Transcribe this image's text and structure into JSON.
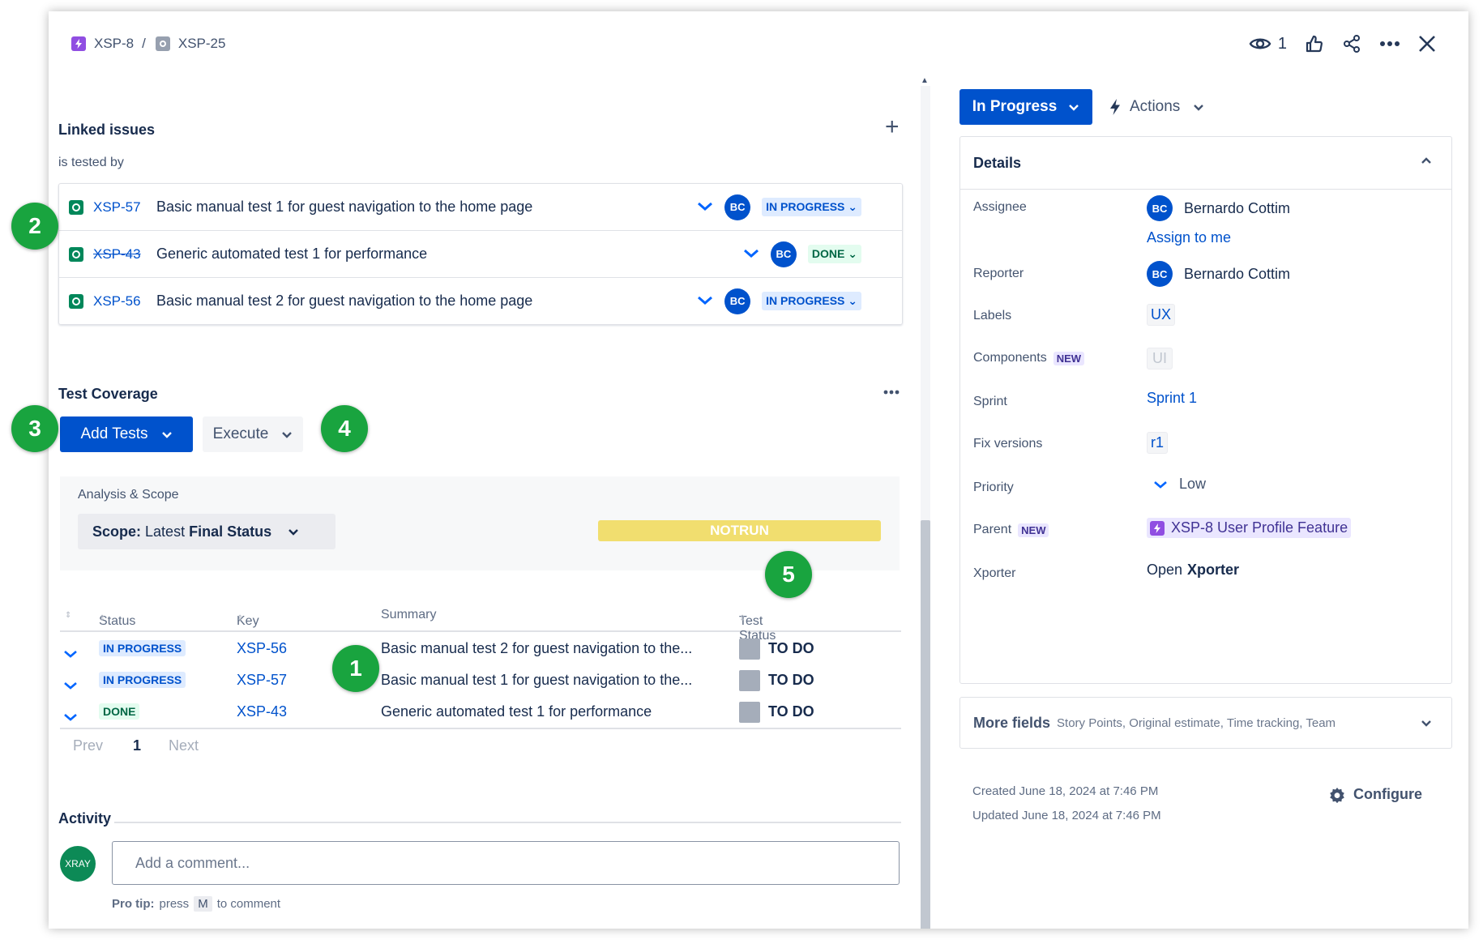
{
  "breadcrumb": {
    "parent_key": "XSP-8",
    "separator": "/",
    "current_key": "XSP-25"
  },
  "header": {
    "watch_count": "1"
  },
  "linked_issues": {
    "title": "Linked issues",
    "relation": "is tested by",
    "rows": [
      {
        "key": "XSP-57",
        "summary": "Basic manual test 1 for guest navigation to the home page",
        "assignee": "BC",
        "status": "IN PROGRESS",
        "done": false
      },
      {
        "key": "XSP-43",
        "summary": "Generic automated test 1 for performance",
        "assignee": "BC",
        "status": "DONE",
        "done": true
      },
      {
        "key": "XSP-56",
        "summary": "Basic manual test 2 for guest navigation to the home page",
        "assignee": "BC",
        "status": "IN PROGRESS",
        "done": false
      }
    ]
  },
  "test_coverage": {
    "title": "Test Coverage",
    "add_tests": "Add Tests",
    "execute": "Execute",
    "analysis_label": "Analysis & Scope",
    "scope_prefix": "Scope:",
    "scope_mid": "Latest",
    "scope_value": "Final Status",
    "overall_status": "NOTRUN",
    "columns": {
      "status": "Status",
      "key": "Key",
      "summary": "Summary",
      "test_status": "Test Status"
    },
    "rows": [
      {
        "status": "IN PROGRESS",
        "key": "XSP-56",
        "summary": "Basic manual test 2 for guest navigation to the...",
        "test_status": "TO DO"
      },
      {
        "status": "IN PROGRESS",
        "key": "XSP-57",
        "summary": "Basic manual test 1 for guest navigation to the...",
        "test_status": "TO DO"
      },
      {
        "status": "DONE",
        "key": "XSP-43",
        "summary": "Generic automated test 1 for performance",
        "test_status": "TO DO"
      }
    ],
    "pager": {
      "prev": "Prev",
      "page": "1",
      "next": "Next"
    }
  },
  "activity": {
    "title": "Activity",
    "avatar": "XRAY",
    "placeholder": "Add a comment...",
    "protip_bold": "Pro tip:",
    "protip_press": "press",
    "protip_key": "M",
    "protip_tail": "to comment"
  },
  "callouts": [
    "1",
    "2",
    "3",
    "4",
    "5"
  ],
  "right": {
    "status": "In Progress",
    "actions": "Actions",
    "details_title": "Details",
    "fields": {
      "assignee_label": "Assignee",
      "assignee_initials": "BC",
      "assignee_name": "Bernardo Cottim",
      "assign_to_me": "Assign to me",
      "reporter_label": "Reporter",
      "reporter_initials": "BC",
      "reporter_name": "Bernardo Cottim",
      "labels_label": "Labels",
      "labels_value": "UX",
      "components_label": "Components",
      "components_new": "NEW",
      "components_value": "UI",
      "sprint_label": "Sprint",
      "sprint_value": "Sprint 1",
      "fix_label": "Fix versions",
      "fix_value": "r1",
      "priority_label": "Priority",
      "priority_value": "Low",
      "parent_label": "Parent",
      "parent_new": "NEW",
      "parent_value": "XSP-8 User Profile Feature",
      "xporter_label": "Xporter",
      "xporter_open": "Open",
      "xporter_name": "Xporter"
    },
    "more_fields_title": "More fields",
    "more_fields_sub": "Story Points, Original estimate, Time tracking, Team",
    "created": "Created June 18, 2024 at 7:46 PM",
    "updated": "Updated June 18, 2024 at 7:46 PM",
    "configure": "Configure"
  },
  "colors": {
    "primary": "#0052cc",
    "badge_green": "#19a43f",
    "notrun": "#f1de6f",
    "test_icon": "#00875a"
  }
}
